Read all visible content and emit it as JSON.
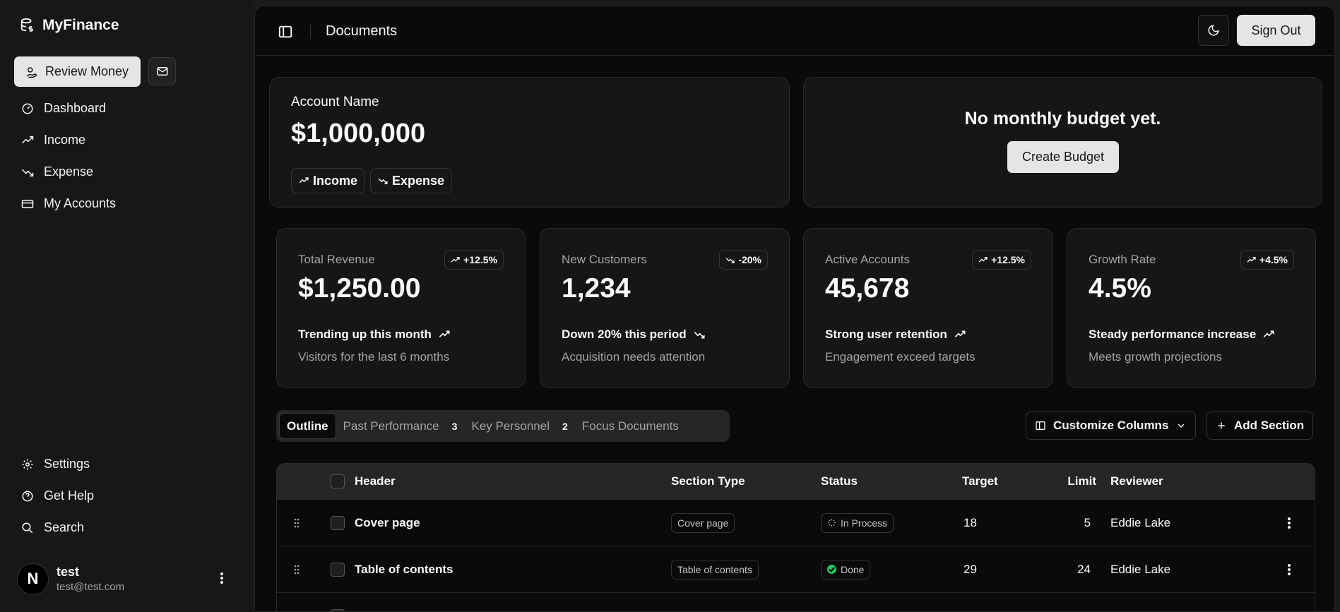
{
  "brand": {
    "name": "MyFinance"
  },
  "sidebar": {
    "review_label": "Review Money",
    "nav": [
      {
        "label": "Dashboard"
      },
      {
        "label": "Income"
      },
      {
        "label": "Expense"
      },
      {
        "label": "My Accounts"
      }
    ],
    "bottom": [
      {
        "label": "Settings"
      },
      {
        "label": "Get Help"
      },
      {
        "label": "Search"
      }
    ],
    "user": {
      "initial": "N",
      "name": "test",
      "email": "test@test.com"
    }
  },
  "header": {
    "title": "Documents",
    "signout_label": "Sign Out"
  },
  "account": {
    "label": "Account Name",
    "value": "$1,000,000",
    "income_label": "Income",
    "expense_label": "Expense"
  },
  "budget": {
    "title": "No monthly budget yet.",
    "button": "Create Budget"
  },
  "stats": [
    {
      "label": "Total Revenue",
      "badge": "+12.5%",
      "value": "$1,250.00",
      "trend": "Trending up this month",
      "sub": "Visitors for the last 6 months"
    },
    {
      "label": "New Customers",
      "badge": "-20%",
      "value": "1,234",
      "trend": "Down 20% this period",
      "sub": "Acquisition needs attention"
    },
    {
      "label": "Active Accounts",
      "badge": "+12.5%",
      "value": "45,678",
      "trend": "Strong user retention",
      "sub": "Engagement exceed targets"
    },
    {
      "label": "Growth Rate",
      "badge": "+4.5%",
      "value": "4.5%",
      "trend": "Steady performance increase",
      "sub": "Meets growth projections"
    }
  ],
  "tabs": [
    {
      "label": "Outline",
      "count": ""
    },
    {
      "label": "Past Performance",
      "count": "3"
    },
    {
      "label": "Key Personnel",
      "count": "2"
    },
    {
      "label": "Focus Documents",
      "count": ""
    }
  ],
  "toolbar": {
    "customize_label": "Customize Columns",
    "add_label": "Add Section"
  },
  "table": {
    "columns": {
      "header": "Header",
      "section_type": "Section Type",
      "status": "Status",
      "target": "Target",
      "limit": "Limit",
      "reviewer": "Reviewer"
    },
    "rows": [
      {
        "header": "Cover page",
        "section_type": "Cover page",
        "status": "In Process",
        "target": "18",
        "limit": "5",
        "reviewer": "Eddie Lake"
      },
      {
        "header": "Table of contents",
        "section_type": "Table of contents",
        "status": "Done",
        "target": "29",
        "limit": "24",
        "reviewer": "Eddie Lake"
      }
    ]
  },
  "colors": {
    "success": "#22c55e",
    "background": "#0a0a0a",
    "sidebar": "#171717"
  }
}
